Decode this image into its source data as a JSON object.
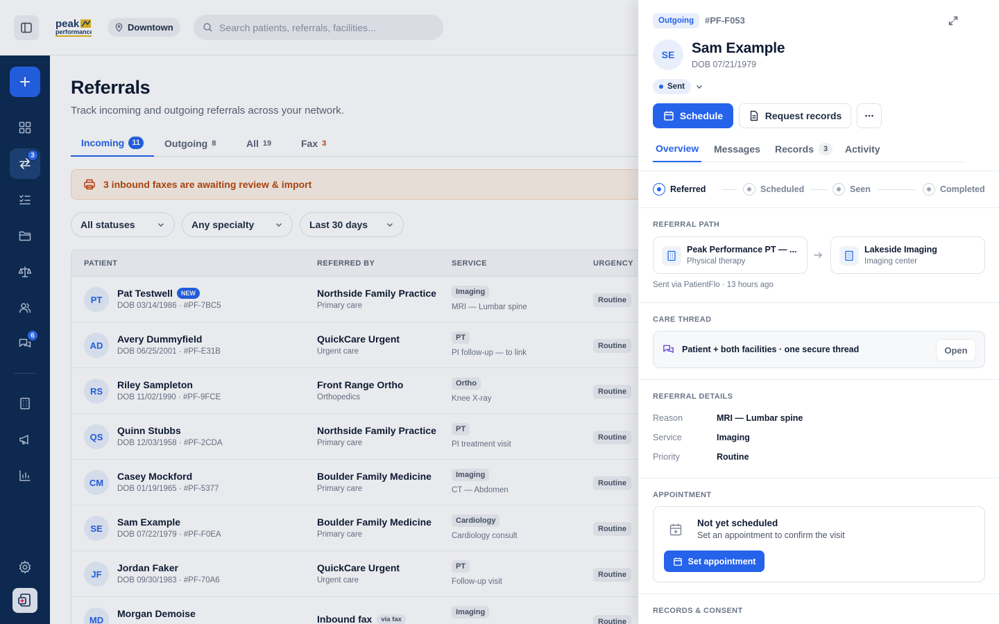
{
  "header": {
    "location": "Downtown",
    "search_placeholder": "Search patients, referrals, facilities..."
  },
  "sidebar": {
    "items": [
      {
        "name": "dashboard",
        "icon": "grid-icon"
      },
      {
        "name": "referrals",
        "icon": "swap-arrows-icon",
        "badge": "3"
      },
      {
        "name": "tasks",
        "icon": "checklist-icon"
      },
      {
        "name": "documents",
        "icon": "folder-icon"
      },
      {
        "name": "legal",
        "icon": "scales-icon"
      },
      {
        "name": "patients",
        "icon": "users-icon"
      },
      {
        "name": "messages",
        "icon": "chat-icon",
        "badge": "6"
      },
      {
        "name": "facilities",
        "icon": "building-icon"
      },
      {
        "name": "marketing",
        "icon": "megaphone-icon"
      },
      {
        "name": "reports",
        "icon": "bar-chart-icon"
      },
      {
        "name": "settings",
        "icon": "gear-icon"
      }
    ]
  },
  "page": {
    "title": "Referrals",
    "subtitle": "Track incoming and outgoing referrals across your network."
  },
  "tabs": [
    {
      "label": "Incoming",
      "count": "11"
    },
    {
      "label": "Outgoing",
      "count": "8"
    },
    {
      "label": "All",
      "count": "19"
    },
    {
      "label": "Fax",
      "count": "3"
    }
  ],
  "fax_banner": "3 inbound faxes are awaiting review & import",
  "filters": [
    "All statuses",
    "Any specialty",
    "Last 30 days"
  ],
  "table": {
    "headers": [
      "PATIENT",
      "REFERRED BY",
      "SERVICE",
      "URGENCY"
    ],
    "rows": [
      {
        "initials": "PT",
        "name": "Pat Testwell",
        "new": "NEW",
        "meta": "DOB 03/14/1986 · #PF-7BC5",
        "referred_by": "Northside Family Practice",
        "referred_sub": "Primary care",
        "service": "Imaging",
        "service_sub": "MRI — Lumbar spine",
        "urgency": "Routine"
      },
      {
        "initials": "AD",
        "name": "Avery Dummyfield",
        "meta": "DOB 06/25/2001 · #PF-E31B",
        "referred_by": "QuickCare Urgent",
        "referred_sub": "Urgent care",
        "service": "PT",
        "service_sub": "PI follow-up — to link",
        "urgency": "Routine"
      },
      {
        "initials": "RS",
        "name": "Riley Sampleton",
        "meta": "DOB 11/02/1990 · #PF-9FCE",
        "referred_by": "Front Range Ortho",
        "referred_sub": "Orthopedics",
        "service": "Ortho",
        "service_sub": "Knee X-ray",
        "urgency": "Routine"
      },
      {
        "initials": "QS",
        "name": "Quinn Stubbs",
        "meta": "DOB 12/03/1958 · #PF-2CDA",
        "referred_by": "Northside Family Practice",
        "referred_sub": "Primary care",
        "service": "PT",
        "service_sub": "PI treatment visit",
        "urgency": "Routine"
      },
      {
        "initials": "CM",
        "name": "Casey Mockford",
        "meta": "DOB 01/19/1965 · #PF-5377",
        "referred_by": "Boulder Family Medicine",
        "referred_sub": "Primary care",
        "service": "Imaging",
        "service_sub": "CT — Abdomen",
        "urgency": "Routine"
      },
      {
        "initials": "SE",
        "name": "Sam Example",
        "meta": "DOB 07/22/1979 · #PF-F0EA",
        "referred_by": "Boulder Family Medicine",
        "referred_sub": "Primary care",
        "service": "Cardiology",
        "service_sub": "Cardiology consult",
        "urgency": "Routine"
      },
      {
        "initials": "JF",
        "name": "Jordan Faker",
        "meta": "DOB 09/30/1983 · #PF-70A6",
        "referred_by": "QuickCare Urgent",
        "referred_sub": "Urgent care",
        "service": "PT",
        "service_sub": "Follow-up visit",
        "urgency": "Routine"
      },
      {
        "initials": "MD",
        "name": "Morgan Demoise",
        "meta": "",
        "referred_by": "Inbound fax",
        "via": "via fax",
        "referred_sub": "",
        "service": "Imaging",
        "service_sub": "",
        "urgency": "Routine"
      }
    ]
  },
  "panel": {
    "direction": "Outgoing",
    "id": "#PF-F053",
    "initials": "SE",
    "name": "Sam Example",
    "dob": "DOB 07/21/1979",
    "status": "Sent",
    "actions": {
      "schedule": "Schedule",
      "request_records": "Request records"
    },
    "tabs": [
      {
        "label": "Overview"
      },
      {
        "label": "Messages"
      },
      {
        "label": "Records",
        "count": "3"
      },
      {
        "label": "Activity"
      }
    ],
    "steps": [
      "Referred",
      "Scheduled",
      "Seen",
      "Completed"
    ],
    "referral_path": {
      "label": "REFERRAL PATH",
      "from_name": "Peak Performance PT — ...",
      "from_type": "Physical therapy",
      "to_name": "Lakeside Imaging",
      "to_type": "Imaging center",
      "sent_via": "Sent via PatientFlo · 13 hours ago"
    },
    "care_thread": {
      "label": "CARE THREAD",
      "text": "Patient + both facilities · one secure thread",
      "open": "Open"
    },
    "details": {
      "label": "REFERRAL DETAILS",
      "rows": [
        {
          "k": "Reason",
          "v": "MRI — Lumbar spine"
        },
        {
          "k": "Service",
          "v": "Imaging"
        },
        {
          "k": "Priority",
          "v": "Routine"
        }
      ]
    },
    "appointment": {
      "label": "APPOINTMENT",
      "title": "Not yet scheduled",
      "subtitle": "Set an appointment to confirm the visit",
      "button": "Set appointment"
    },
    "records_label": "RECORDS & CONSENT"
  },
  "colors": {
    "accent": "#2563eb",
    "sidebar": "#0e2b52",
    "warning": "#b54708"
  }
}
